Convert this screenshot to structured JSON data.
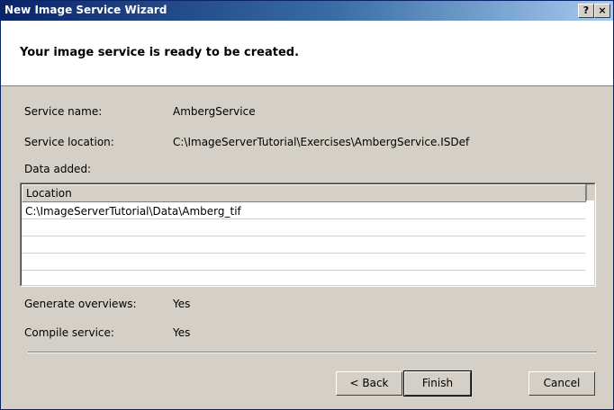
{
  "window": {
    "title": "New Image Service Wizard",
    "help_label": "?",
    "close_label": "×"
  },
  "header": {
    "heading": "Your image service is ready to be created."
  },
  "summary": {
    "service_name_label": "Service name:",
    "service_name_value": "AmbergService",
    "service_location_label": "Service location:",
    "service_location_value": "C:\\ImageServerTutorial\\Exercises\\AmbergService.ISDef",
    "data_added_label": "Data added:",
    "generate_overviews_label": "Generate overviews:",
    "generate_overviews_value": "Yes",
    "compile_service_label": "Compile service:",
    "compile_service_value": "Yes"
  },
  "data_table": {
    "column_header": "Location",
    "rows": [
      "C:\\ImageServerTutorial\\Data\\Amberg_tif",
      "",
      "",
      "",
      ""
    ]
  },
  "buttons": {
    "back": "< Back",
    "finish": "Finish",
    "cancel": "Cancel"
  }
}
